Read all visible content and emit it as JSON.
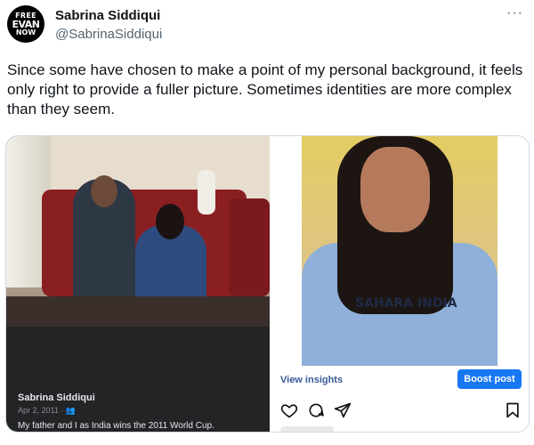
{
  "author": {
    "avatar_lines": [
      "FREE",
      "EVAN",
      "NOW"
    ],
    "display_name": "Sabrina Siddiqui",
    "handle": "@SabrinaSiddiqui",
    "more_icon": "more-icon"
  },
  "tweet": {
    "text": "Since some have chosen to make a point of my personal background, it feels only right to provide a fuller picture. Sometimes identities are more complex than they seem."
  },
  "left_card": {
    "poster_name": "Sabrina Siddiqui",
    "date": "Apr 2, 2011 · 👥",
    "caption": "My father and I as India wins the 2011 World Cup."
  },
  "right_card": {
    "shirt_text": "SAHARA INDIA",
    "view_insights_label": "View insights",
    "boost_label": "Boost post",
    "icons": [
      "heart-icon",
      "comment-icon",
      "share-icon",
      "bookmark-icon"
    ]
  },
  "colors": {
    "link_blue": "#385898",
    "boost_blue": "#1877f2",
    "text_primary": "#0f1419",
    "text_secondary": "#536471"
  }
}
